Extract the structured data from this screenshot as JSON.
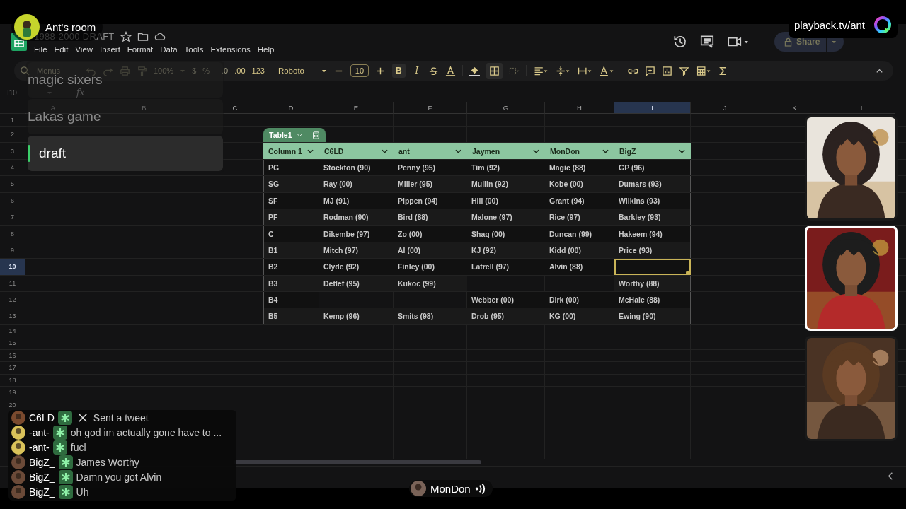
{
  "stream": {
    "room": "Ant's room",
    "url": "playback.tv/ant"
  },
  "rooms": [
    {
      "name": "magic sixers",
      "selected": false
    },
    {
      "name": "Lakas game",
      "selected": false
    },
    {
      "name": "draft",
      "selected": true
    }
  ],
  "sheet": {
    "title": "1988-2000 DRAFT",
    "menu": [
      "File",
      "Edit",
      "View",
      "Insert",
      "Format",
      "Data",
      "Tools",
      "Extensions",
      "Help"
    ],
    "share": "Share",
    "toolbar": {
      "search_placeholder": "Menus",
      "zoom": "100%",
      "currency": "$",
      "percent": "%",
      "decimal_decrease": ".0",
      "decimal_increase": ".00",
      "number_format": "123",
      "font": "Roboto",
      "font_size": "10",
      "bold": "B",
      "italic": "I"
    },
    "name_box": "I10",
    "formula_label": "fx",
    "columns": [
      {
        "label": "A",
        "selected": false
      },
      {
        "label": "B",
        "selected": false
      },
      {
        "label": "C",
        "selected": false
      },
      {
        "label": "D",
        "selected": false
      },
      {
        "label": "E",
        "selected": false
      },
      {
        "label": "F",
        "selected": false
      },
      {
        "label": "G",
        "selected": false
      },
      {
        "label": "H",
        "selected": false
      },
      {
        "label": "I",
        "selected": true
      },
      {
        "label": "J",
        "selected": false
      },
      {
        "label": "K",
        "selected": false
      },
      {
        "label": "L",
        "selected": false
      }
    ],
    "rows": [
      {
        "label": "1",
        "selected": false
      },
      {
        "label": "2",
        "selected": false
      },
      {
        "label": "3",
        "selected": false
      },
      {
        "label": "4",
        "selected": false
      },
      {
        "label": "5",
        "selected": false
      },
      {
        "label": "6",
        "selected": false
      },
      {
        "label": "7",
        "selected": false
      },
      {
        "label": "8",
        "selected": false
      },
      {
        "label": "9",
        "selected": false
      },
      {
        "label": "10",
        "selected": true
      },
      {
        "label": "11",
        "selected": false
      },
      {
        "label": "12",
        "selected": false
      },
      {
        "label": "13",
        "selected": false
      },
      {
        "label": "14",
        "selected": false
      },
      {
        "label": "15",
        "selected": false
      },
      {
        "label": "16",
        "selected": false
      },
      {
        "label": "17",
        "selected": false
      },
      {
        "label": "18",
        "selected": false
      },
      {
        "label": "19",
        "selected": false
      },
      {
        "label": "20",
        "selected": false
      }
    ],
    "table": {
      "name": "Table1",
      "columns": [
        "Column 1",
        "C6LD",
        "ant",
        "Jaymen",
        "MonDon",
        "BigZ"
      ],
      "rows": [
        [
          "PG",
          "Stockton (90)",
          "Penny (95)",
          "Tim (92)",
          "Magic (88)",
          "GP (96)"
        ],
        [
          "SG",
          "Ray (00)",
          "Miller (95)",
          "Mullin (92)",
          "Kobe (00)",
          "Dumars (93)"
        ],
        [
          "SF",
          "MJ (91)",
          "Pippen (94)",
          "Hill (00)",
          "Grant (94)",
          "Wilkins (93)"
        ],
        [
          "PF",
          "Rodman (90)",
          "Bird (88)",
          "Malone (97)",
          "Rice (97)",
          "Barkley (93)"
        ],
        [
          "C",
          "Dikembe (97)",
          "Zo (00)",
          "Shaq (00)",
          "Duncan (99)",
          "Hakeem (94)"
        ],
        [
          "B1",
          "Mitch (97)",
          "AI (00)",
          "KJ (92)",
          "Kidd (00)",
          "Price (93)"
        ],
        [
          "B2",
          "Clyde (92)",
          "Finley (00)",
          "Latrell (97)",
          "Alvin (88)",
          null
        ],
        [
          "B3",
          "Detlef (95)",
          "Kukoc (99)",
          null,
          null,
          "Worthy (88)"
        ],
        [
          "B4",
          null,
          null,
          "Webber (00)",
          "Dirk (00)",
          "McHale (88)"
        ],
        [
          "B5",
          "Kemp (96)",
          "Smits (98)",
          "Drob (95)",
          "KG (00)",
          "Ewing (90)"
        ]
      ]
    }
  },
  "chat": [
    {
      "user": "C6LD",
      "kind": "tweet",
      "text": "Sent a tweet"
    },
    {
      "user": "-ant-",
      "kind": "message",
      "text": "oh god im actually gone have to ..."
    },
    {
      "user": "-ant-",
      "kind": "message",
      "text": "fucl"
    },
    {
      "user": "BigZ_",
      "kind": "message",
      "text": "James Worthy"
    },
    {
      "user": "BigZ_",
      "kind": "message",
      "text": "Damn you got Alvin"
    },
    {
      "user": "BigZ_",
      "kind": "message",
      "text": "Uh"
    }
  ],
  "speaker": {
    "name": "MonDon"
  },
  "videos": [
    {
      "kind": "picture",
      "speaking": false
    },
    {
      "kind": "picture",
      "speaking": true
    },
    {
      "kind": "picture",
      "speaking": false
    }
  ]
}
